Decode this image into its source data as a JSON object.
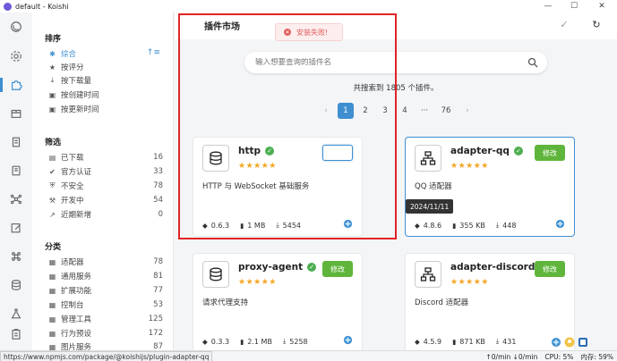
{
  "window": {
    "title": "default - Koishi",
    "minimize": "—",
    "maximize": "☐",
    "close": "✕"
  },
  "sidebar": {
    "sort_title": "排序",
    "sort_items": [
      {
        "label": "综合",
        "icon": "✱",
        "active": true
      },
      {
        "label": "按评分",
        "icon": "★"
      },
      {
        "label": "按下载量",
        "icon": "⤓"
      },
      {
        "label": "按创建时间",
        "icon": "▣"
      },
      {
        "label": "按更新时间",
        "icon": "▣"
      }
    ],
    "sort_order_icon": "↑≡",
    "filter_title": "筛选",
    "filter_items": [
      {
        "label": "已下载",
        "icon": "▤",
        "count": "16"
      },
      {
        "label": "官方认证",
        "icon": "✔",
        "count": "33"
      },
      {
        "label": "不安全",
        "icon": "⛨",
        "count": "78"
      },
      {
        "label": "开发中",
        "icon": "⚒",
        "count": "54"
      },
      {
        "label": "近期新增",
        "icon": "↗",
        "count": "0"
      }
    ],
    "category_title": "分类",
    "category_items": [
      {
        "label": "适配器",
        "icon": "▦",
        "count": "78"
      },
      {
        "label": "通用服务",
        "icon": "▦",
        "count": "81"
      },
      {
        "label": "扩展功能",
        "icon": "▦",
        "count": "77"
      },
      {
        "label": "控制台",
        "icon": "▦",
        "count": "53"
      },
      {
        "label": "管理工具",
        "icon": "▦",
        "count": "125"
      },
      {
        "label": "行为预设",
        "icon": "▦",
        "count": "172"
      },
      {
        "label": "图片服务",
        "icon": "▦",
        "count": "87"
      }
    ]
  },
  "header": {
    "title": "插件市场",
    "confirm_icon": "✓",
    "refresh_icon": "↻"
  },
  "toast": {
    "icon": "✕",
    "text": "安装失败!"
  },
  "search": {
    "placeholder": "输入想要查询的插件名",
    "value": ""
  },
  "summary": "共搜索到 1805 个插件。",
  "pagination": {
    "prev": "‹",
    "next": "›",
    "pages": [
      "1",
      "2",
      "3",
      "4",
      "···",
      "76"
    ],
    "active": "1"
  },
  "plugins": [
    {
      "name": "http",
      "stars": "★★★★★",
      "desc": "HTTP 与 WebSocket 基础服务",
      "version": "0.6.3",
      "size": "1 MB",
      "downloads": "5454",
      "button": "",
      "icon": "database"
    },
    {
      "name": "adapter-qq",
      "stars": "★★★★★",
      "desc": "QQ 适配器",
      "version": "4.8.6",
      "size": "355 KB",
      "downloads": "448",
      "button": "修改",
      "icon": "network"
    },
    {
      "name": "proxy-agent",
      "stars": "★★★★★",
      "desc": "请求代理支持",
      "version": "0.3.3",
      "size": "2.1 MB",
      "downloads": "5258",
      "button": "修改",
      "icon": "database"
    },
    {
      "name": "adapter-discord",
      "stars": "★★★★★",
      "desc": "Discord 适配器",
      "version": "4.5.9",
      "size": "871 KB",
      "downloads": "431",
      "button": "修改",
      "icon": "network"
    }
  ],
  "tooltip": "2024/11/11",
  "statusbar": {
    "url": "https://www.npmjs.com/package/@koishijs/plugin-adapter-qq",
    "net": "↑0/min ↓0/min",
    "cpu": "CPU: 5%",
    "mem": "内存: 59%"
  },
  "colors": {
    "accent": "#3e8ed0",
    "success": "#5fb53c",
    "error": "#e05a5a",
    "highlight_box": "#e02424"
  }
}
